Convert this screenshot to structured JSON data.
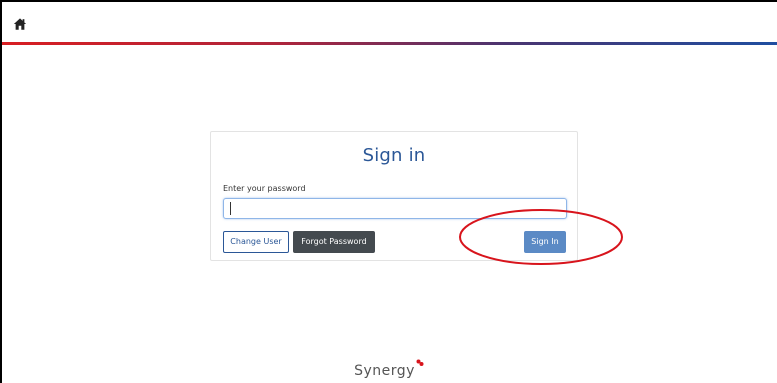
{
  "header": {
    "home_icon": "home-icon"
  },
  "colors": {
    "accent_start": "#d81e22",
    "accent_end": "#1f4ea0",
    "title": "#2b5797",
    "primary_button": "#5b8ac5",
    "dark_button": "#444a4f",
    "highlight": "#d8141c"
  },
  "signin": {
    "title": "Sign in",
    "password_label": "Enter your password",
    "password_value": "",
    "change_user_label": "Change User",
    "forgot_password_label": "Forgot Password",
    "sign_in_label": "Sign In"
  },
  "footer": {
    "logo_text": "Synergy"
  }
}
